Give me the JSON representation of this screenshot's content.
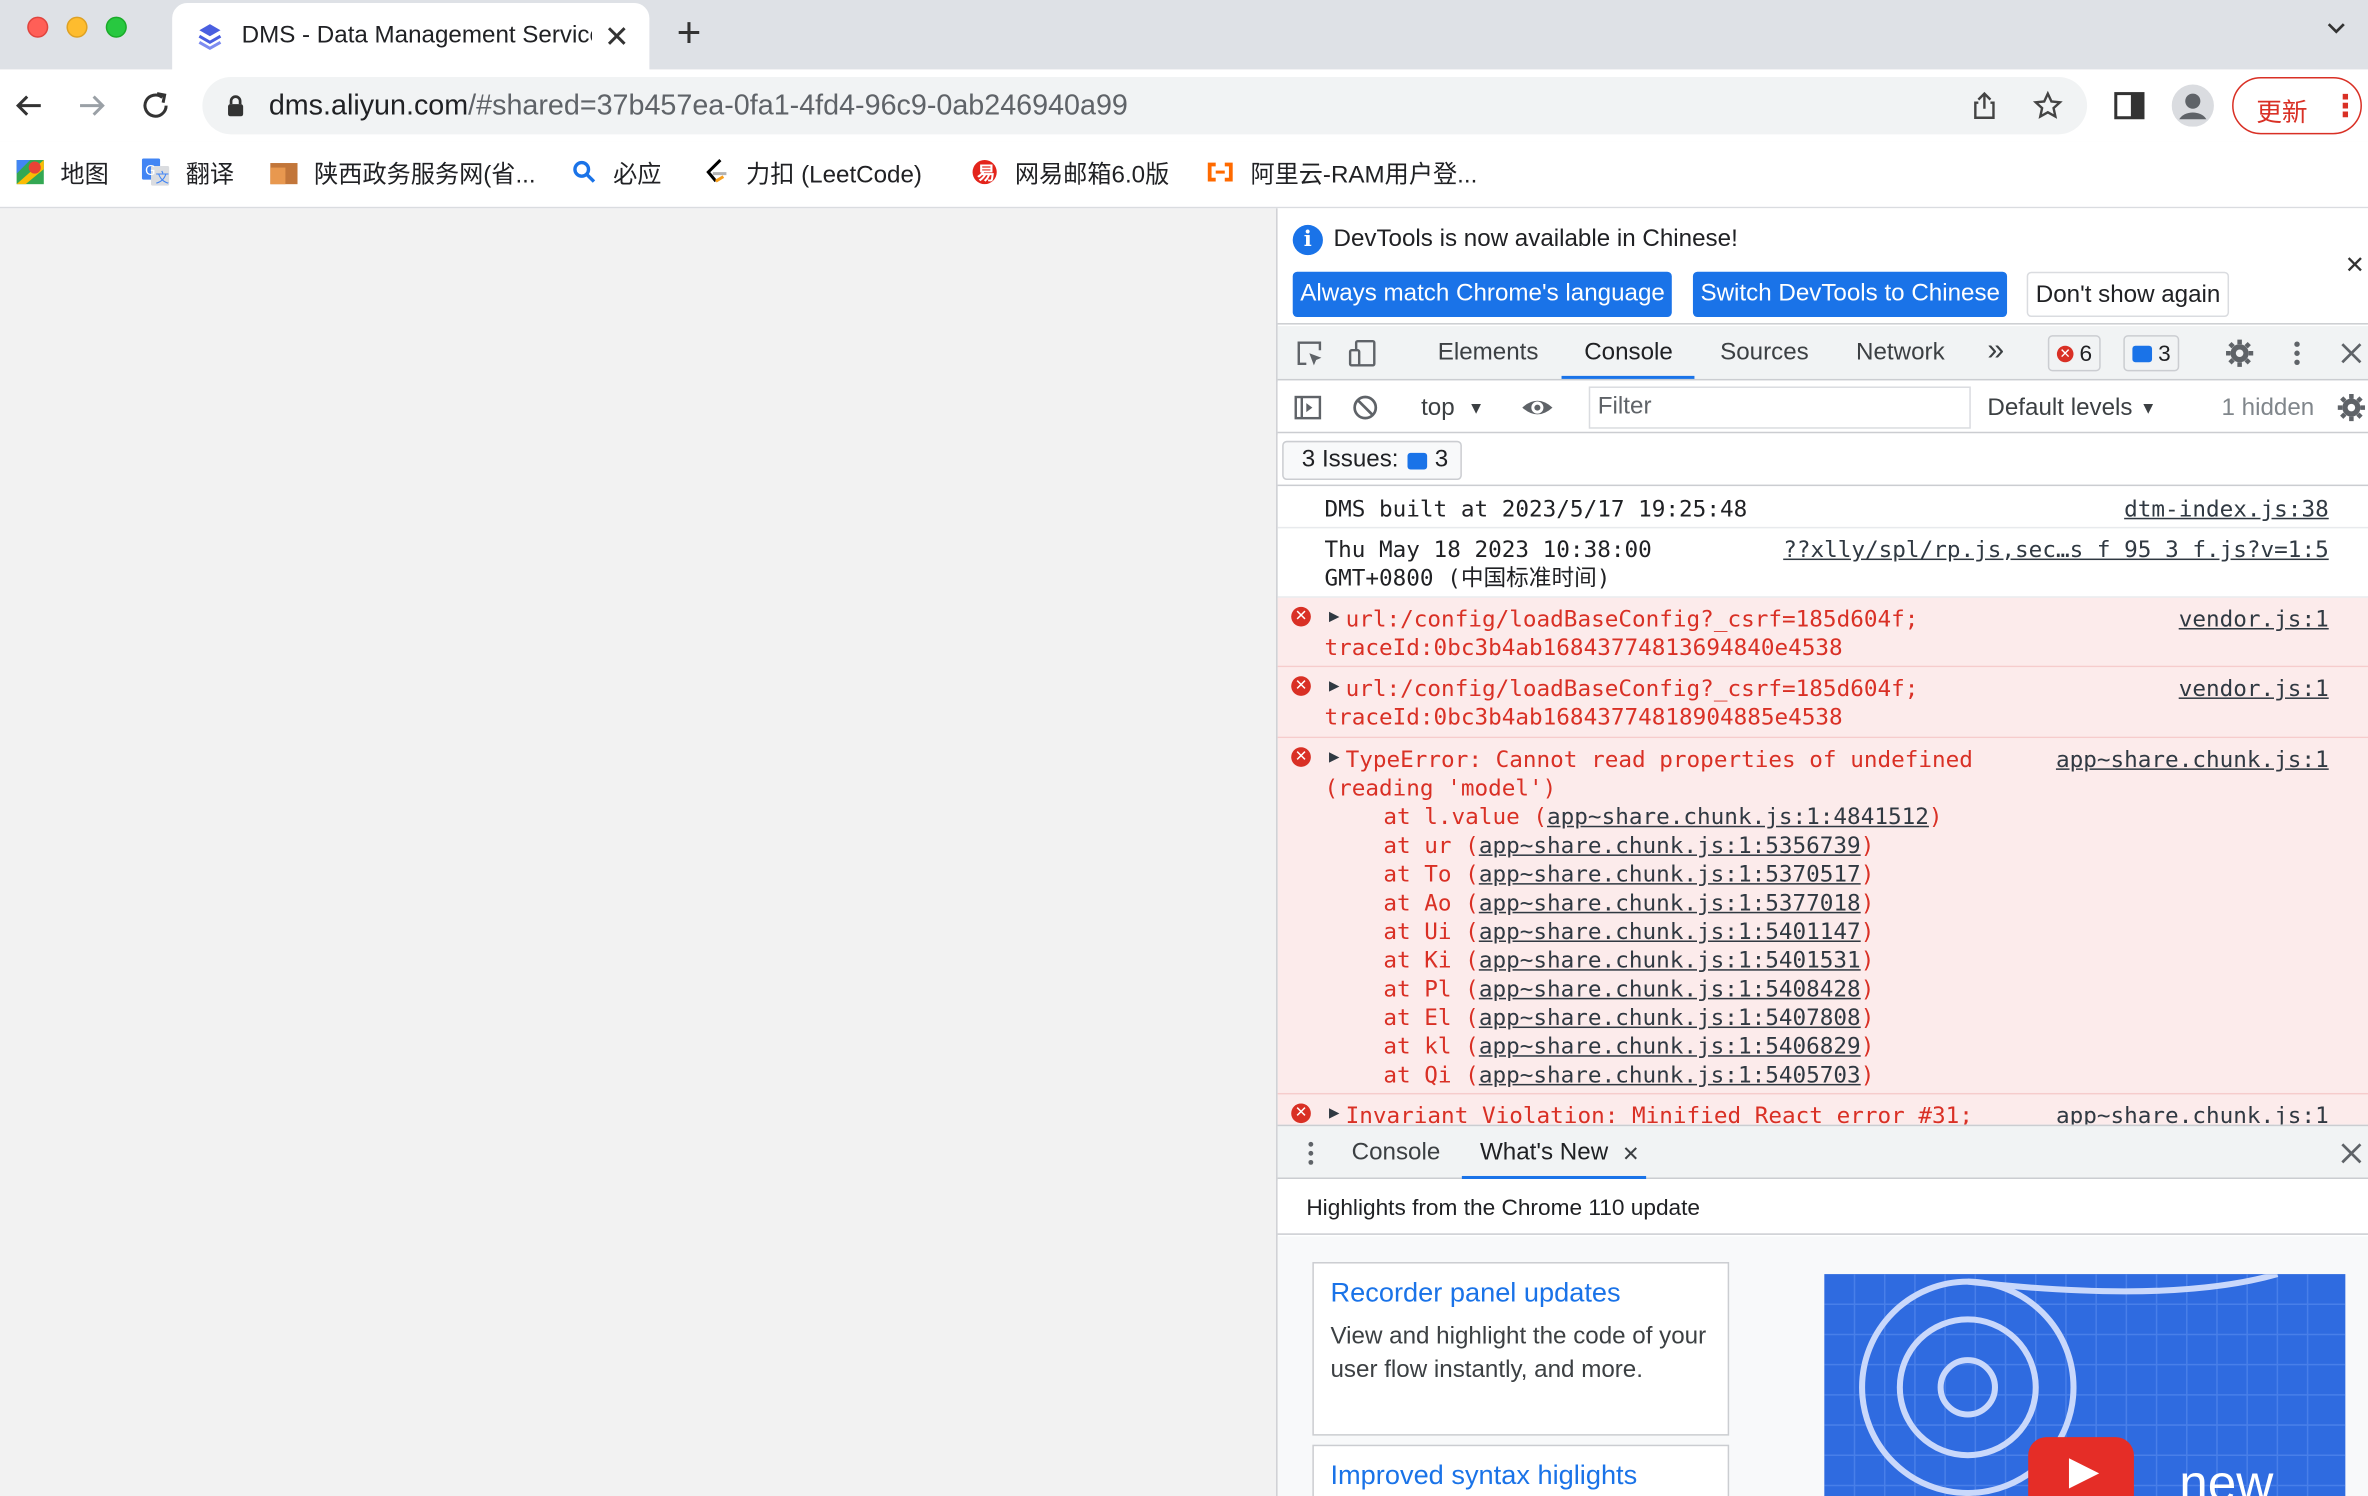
{
  "browser": {
    "tab_title": "DMS - Data Management Service",
    "new_tab_glyph": "+",
    "close_glyph": "✕",
    "url_host": "dms.aliyun.com",
    "url_rest": "/#shared=37b457ea-0fa1-4fd4-96c9-0ab246940a99",
    "update_label": "更新",
    "menu_glyph": "⋮"
  },
  "bookmarks": [
    {
      "label": "地图",
      "icon": "google-maps-icon"
    },
    {
      "label": "翻译",
      "icon": "google-translate-icon"
    },
    {
      "label": "陕西政务服务网(省...",
      "icon": "folder-icon"
    },
    {
      "label": "必应",
      "icon": "search-icon"
    },
    {
      "label": "力扣 (LeetCode)",
      "icon": "leetcode-icon"
    },
    {
      "label": "网易邮箱6.0版",
      "icon": "netease-mail-icon"
    },
    {
      "label": "阿里云-RAM用户登...",
      "icon": "aliyun-icon"
    }
  ],
  "devtools": {
    "infobar": {
      "message": "DevTools is now available in Chinese!",
      "btn_match": "Always match Chrome's language",
      "btn_switch": "Switch DevTools to Chinese",
      "btn_dismiss": "Don't show again"
    },
    "tabs": {
      "elements": "Elements",
      "console": "Console",
      "sources": "Sources",
      "network": "Network",
      "more": "»",
      "error_count": "6",
      "message_count": "3"
    },
    "console_toolbar": {
      "context": "top",
      "filter_placeholder": "Filter",
      "levels": "Default levels",
      "hidden": "1 hidden"
    },
    "issues": {
      "label": "3 Issues:",
      "count": "3"
    },
    "messages": [
      {
        "type": "log",
        "text": "DMS built at 2023/5/17 19:25:48",
        "source": "dtm-index.js:38"
      },
      {
        "type": "log",
        "text": "Thu May 18 2023 10:38:00",
        "text2": "GMT+0800 (中国标准时间)",
        "source": "??xlly/spl/rp.js,sec…s f 95 3 f.js?v=1:5"
      },
      {
        "type": "error",
        "text": "url:/config/loadBaseConfig?_csrf=185d604f;",
        "text2": "traceId:0bc3b4ab16843774813694840e4538",
        "source": "vendor.js:1"
      },
      {
        "type": "error",
        "text": "url:/config/loadBaseConfig?_csrf=185d604f;",
        "text2": "traceId:0bc3b4ab16843774818904885e4538",
        "source": "vendor.js:1"
      },
      {
        "type": "error",
        "text": "TypeError: Cannot read properties of undefined",
        "text2": "(reading 'model')",
        "source": "app~share.chunk.js:1"
      },
      {
        "type": "error",
        "text": "Invariant Violation: Minified React error #31;",
        "source": "app~share.chunk.js:1"
      }
    ],
    "stack": [
      {
        "fn": "at l.value (",
        "loc": "app~share.chunk.js:1:4841512",
        "end": ")"
      },
      {
        "fn": "at ur (",
        "loc": "app~share.chunk.js:1:5356739",
        "end": ")"
      },
      {
        "fn": "at To (",
        "loc": "app~share.chunk.js:1:5370517",
        "end": ")"
      },
      {
        "fn": "at Ao (",
        "loc": "app~share.chunk.js:1:5377018",
        "end": ")"
      },
      {
        "fn": "at Ui (",
        "loc": "app~share.chunk.js:1:5401147",
        "end": ")"
      },
      {
        "fn": "at Ki (",
        "loc": "app~share.chunk.js:1:5401531",
        "end": ")"
      },
      {
        "fn": "at Pl (",
        "loc": "app~share.chunk.js:1:5408428",
        "end": ")"
      },
      {
        "fn": "at El (",
        "loc": "app~share.chunk.js:1:5407808",
        "end": ")"
      },
      {
        "fn": "at kl (",
        "loc": "app~share.chunk.js:1:5406829",
        "end": ")"
      },
      {
        "fn": "at Qi (",
        "loc": "app~share.chunk.js:1:5405703",
        "end": ")"
      }
    ],
    "drawer": {
      "console_tab": "Console",
      "whatsnew_tab": "What's New",
      "headline": "Highlights from the Chrome 110 update",
      "card1_title": "Recorder panel updates",
      "card1_desc": "View and highlight the code of your user flow instantly, and more.",
      "card2_title": "Improved syntax higlights",
      "promo_text": "new"
    }
  },
  "colors": {
    "accent": "#1a73e8",
    "error": "#d93025",
    "error_bg": "#fcebeb"
  }
}
